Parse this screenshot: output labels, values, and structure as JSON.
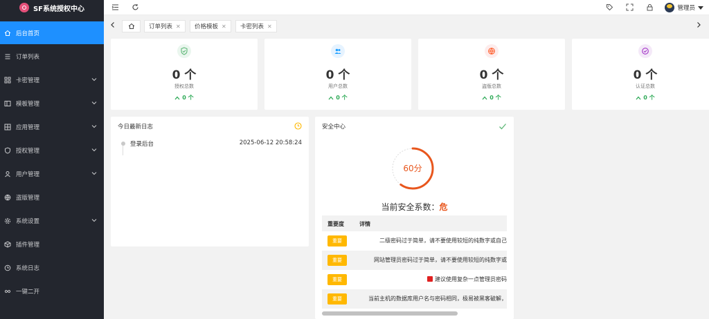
{
  "app": {
    "title": "SF系统授权中心",
    "accent": "#1e90ff",
    "sidebar_bg": "#23262e"
  },
  "sidebar": {
    "items": [
      {
        "label": "后台首页",
        "icon": "home-icon",
        "active": true,
        "expandable": false
      },
      {
        "label": "订单列表",
        "icon": "list-icon",
        "active": false,
        "expandable": false
      },
      {
        "label": "卡密管理",
        "icon": "grid-icon",
        "active": false,
        "expandable": true
      },
      {
        "label": "模板管理",
        "icon": "template-icon",
        "active": false,
        "expandable": true
      },
      {
        "label": "应用管理",
        "icon": "apps-icon",
        "active": false,
        "expandable": true
      },
      {
        "label": "授权管理",
        "icon": "shield-icon",
        "active": false,
        "expandable": true
      },
      {
        "label": "用户管理",
        "icon": "user-icon",
        "active": false,
        "expandable": true
      },
      {
        "label": "盗版管理",
        "icon": "globe-icon",
        "active": false,
        "expandable": false
      },
      {
        "label": "系统设置",
        "icon": "gear-icon",
        "active": false,
        "expandable": true
      },
      {
        "label": "插件管理",
        "icon": "plugin-icon",
        "active": false,
        "expandable": false
      },
      {
        "label": "系统日志",
        "icon": "clock-icon",
        "active": false,
        "expandable": false
      },
      {
        "label": "一键二开",
        "icon": "infinity-icon",
        "active": false,
        "expandable": false
      }
    ]
  },
  "header": {
    "user_name": "管理员",
    "icons": [
      "collapse-menu-icon",
      "refresh-icon",
      "tag-icon",
      "fullscreen-icon",
      "lock-icon"
    ]
  },
  "tabs": [
    {
      "label": "订单列表"
    },
    {
      "label": "价格模板"
    },
    {
      "label": "卡密列表"
    }
  ],
  "stats": [
    {
      "value": "0 个",
      "label": "授权总数",
      "trend": "0 个",
      "icon": "shield-check-icon",
      "color": "#5fb878"
    },
    {
      "value": "0 个",
      "label": "用户总数",
      "trend": "0 个",
      "icon": "users-icon",
      "color": "#1e9fff"
    },
    {
      "value": "0 个",
      "label": "盗版总数",
      "trend": "0 个",
      "icon": "globe-icon",
      "color": "#ff5722"
    },
    {
      "value": "0 个",
      "label": "认证总数",
      "trend": "0 个",
      "icon": "check-circle-icon",
      "color": "#a233c6"
    }
  ],
  "log_panel": {
    "title": "今日最新日志",
    "entries": [
      {
        "text": "登录后台",
        "time": "2025-06-12 20:58:24"
      }
    ]
  },
  "security": {
    "title": "安全中心",
    "score": "60分",
    "score_value": 60,
    "headline": "当前安全系数：",
    "level_word": "危",
    "columns": [
      "重要度",
      "详情"
    ],
    "rows": [
      {
        "level": "重要",
        "detail": "二级密码过于简单，请不要使用较短的纯数字或自己",
        "warn": false
      },
      {
        "level": "重要",
        "detail": "网站管理员密码过于简单，请不要使用较短的纯数字或",
        "warn": false
      },
      {
        "level": "重要",
        "detail": "建议使用复杂一点管理员密码",
        "warn": true
      },
      {
        "level": "重要",
        "detail": "当前主机的数据库用户名与密码相同，极易被黑客破解，",
        "warn": false
      }
    ]
  }
}
